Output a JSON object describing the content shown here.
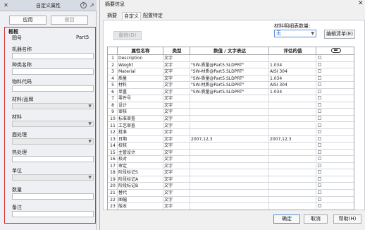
{
  "left_panel": {
    "title": "自定义属性",
    "close_glyph": "✕",
    "help_glyph": "?",
    "pin_glyph": "↗",
    "apply_label": "应用",
    "cancel_label": "撤回",
    "frame_title": "框框",
    "fields": [
      {
        "label": "图号",
        "kind": "value",
        "value": "Part5"
      },
      {
        "label": "机器名称",
        "kind": "text",
        "value": ""
      },
      {
        "label": "种类名称",
        "kind": "text",
        "value": ""
      },
      {
        "label": "物料代码",
        "kind": "text",
        "value": ""
      },
      {
        "label": "材料/品牌",
        "kind": "select",
        "value": ""
      },
      {
        "label": "材料",
        "kind": "select",
        "value": ""
      },
      {
        "label": "面处理",
        "kind": "select",
        "value": ""
      },
      {
        "label": "热处理",
        "kind": "text",
        "value": ""
      },
      {
        "label": "单位",
        "kind": "select",
        "value": ""
      },
      {
        "label": "数量",
        "kind": "text",
        "value": ""
      },
      {
        "label": "备注",
        "kind": "text",
        "value": ""
      }
    ]
  },
  "dialog": {
    "title": "摘要信息",
    "close_glyph": "✕",
    "tabs": [
      "摘要",
      "自定义",
      "配置特定"
    ],
    "delete_label": "删除(D)",
    "bom_label": "材料明细表数量:",
    "bom_value": "无",
    "edit_list_label": "编辑清单(E)",
    "table": {
      "headers": [
        "",
        "属性名称",
        "类型",
        "数值 / 文字表达",
        "评估的值",
        ""
      ],
      "rows": [
        {
          "n": "1",
          "name": "Description",
          "type": "文字",
          "expr": "",
          "val": ""
        },
        {
          "n": "2",
          "name": "Weight",
          "type": "文字",
          "expr": "\"SW-质量@Part5.SLDPRT\"",
          "val": "1.034"
        },
        {
          "n": "3",
          "name": "Material",
          "type": "文字",
          "expr": "\"SW-材质@Part5.SLDPRT\"",
          "val": "AISI 304"
        },
        {
          "n": "4",
          "name": "质量",
          "type": "文字",
          "expr": "\"SW-质量@Part5.SLDPRT\"",
          "val": "1.034"
        },
        {
          "n": "5",
          "name": "材料",
          "type": "文字",
          "expr": "\"SW-材质@Part5.SLDPRT\"",
          "val": "AISI 304"
        },
        {
          "n": "6",
          "name": "单重",
          "type": "文字",
          "expr": "\"SW-质量@Part5.SLDPRT\"",
          "val": "1.034"
        },
        {
          "n": "7",
          "name": "零件号",
          "type": "文字",
          "expr": "",
          "val": ""
        },
        {
          "n": "8",
          "name": "设计",
          "type": "文字",
          "expr": "",
          "val": ""
        },
        {
          "n": "9",
          "name": "审核",
          "type": "文字",
          "expr": "",
          "val": ""
        },
        {
          "n": "10",
          "name": "标准审查",
          "type": "文字",
          "expr": "",
          "val": ""
        },
        {
          "n": "11",
          "name": "工艺审查",
          "type": "文字",
          "expr": "",
          "val": ""
        },
        {
          "n": "12",
          "name": "批准",
          "type": "文字",
          "expr": "",
          "val": ""
        },
        {
          "n": "13",
          "name": "日期",
          "type": "文字",
          "expr": "2007,12,3",
          "val": "2007,12,3"
        },
        {
          "n": "14",
          "name": "校核",
          "type": "文字",
          "expr": "",
          "val": ""
        },
        {
          "n": "15",
          "name": "主管设计",
          "type": "文字",
          "expr": "",
          "val": ""
        },
        {
          "n": "16",
          "name": "校对",
          "type": "文字",
          "expr": "",
          "val": ""
        },
        {
          "n": "17",
          "name": "审定",
          "type": "文字",
          "expr": "",
          "val": ""
        },
        {
          "n": "18",
          "name": "阶段标记S",
          "type": "文字",
          "expr": "",
          "val": ""
        },
        {
          "n": "19",
          "name": "阶段标记A",
          "type": "文字",
          "expr": "",
          "val": ""
        },
        {
          "n": "20",
          "name": "阶段标记B",
          "type": "文字",
          "expr": "",
          "val": ""
        },
        {
          "n": "21",
          "name": "替代",
          "type": "文字",
          "expr": "",
          "val": ""
        },
        {
          "n": "22",
          "name": "图幅",
          "type": "文字",
          "expr": "",
          "val": ""
        },
        {
          "n": "23",
          "name": "版本",
          "type": "文字",
          "expr": "",
          "val": ""
        }
      ]
    },
    "ok_label": "确定",
    "cancel_label": "取消",
    "help_label": "帮助(H)",
    "link_icon": "link-icon",
    "chevron_icon": "chevron-down-icon"
  }
}
